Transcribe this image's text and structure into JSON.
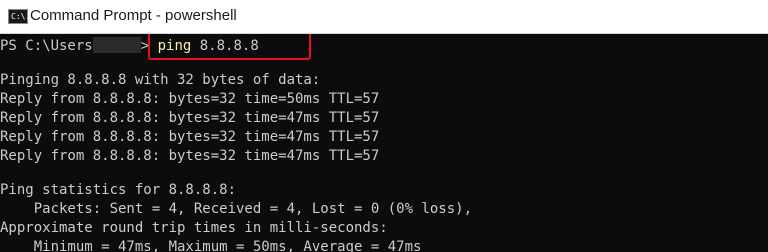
{
  "window": {
    "title": "Command Prompt - powershell",
    "icon": "console-icon",
    "icon_glyph": "C:\\."
  },
  "console": {
    "prompt_prefix": "PS C:\\Users",
    "prompt_suffix": ">",
    "command": "ping",
    "command_args": " 8.8.8.8",
    "output": [
      "Pinging 8.8.8.8 with 32 bytes of data:",
      "Reply from 8.8.8.8: bytes=32 time=50ms TTL=57",
      "Reply from 8.8.8.8: bytes=32 time=47ms TTL=57",
      "Reply from 8.8.8.8: bytes=32 time=47ms TTL=57",
      "Reply from 8.8.8.8: bytes=32 time=47ms TTL=57",
      "Ping statistics for 8.8.8.8:",
      "    Packets: Sent = 4, Received = 4, Lost = 0 (0% loss),",
      "Approximate round trip times in milli-seconds:",
      "    Minimum = 47ms, Maximum = 50ms, Average = 47ms"
    ]
  },
  "colors": {
    "background": "#0c0c0c",
    "text": "#cccccc",
    "command": "#f9f1a5",
    "highlight_border": "#e81123"
  }
}
